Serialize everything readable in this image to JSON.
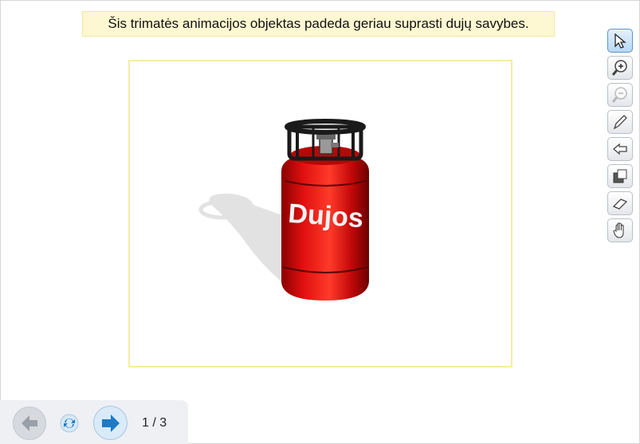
{
  "caption": {
    "text": "Šis trimatės animacijos objektas padeda geriau suprasti dujų savybes."
  },
  "illustration": {
    "cylinder_label": "Dujos",
    "cylinder_color": "#e01010"
  },
  "toolbar": {
    "tools": [
      {
        "name": "select-tool",
        "icon": "arrow-pointer-icon",
        "state": "active"
      },
      {
        "name": "zoom-in-tool",
        "icon": "zoom-in-icon",
        "state": "enabled"
      },
      {
        "name": "zoom-out-tool",
        "icon": "zoom-out-icon",
        "state": "disabled"
      },
      {
        "name": "pen-tool",
        "icon": "pencil-icon",
        "state": "enabled"
      },
      {
        "name": "back-tool",
        "icon": "arrow-left-icon",
        "state": "enabled"
      },
      {
        "name": "layers-tool",
        "icon": "layers-icon",
        "state": "enabled"
      },
      {
        "name": "eraser-tool",
        "icon": "eraser-icon",
        "state": "enabled"
      },
      {
        "name": "hand-tool",
        "icon": "hand-icon",
        "state": "enabled"
      }
    ]
  },
  "nav": {
    "page_indicator": "1 / 3",
    "accent": "#1e7ac6"
  }
}
